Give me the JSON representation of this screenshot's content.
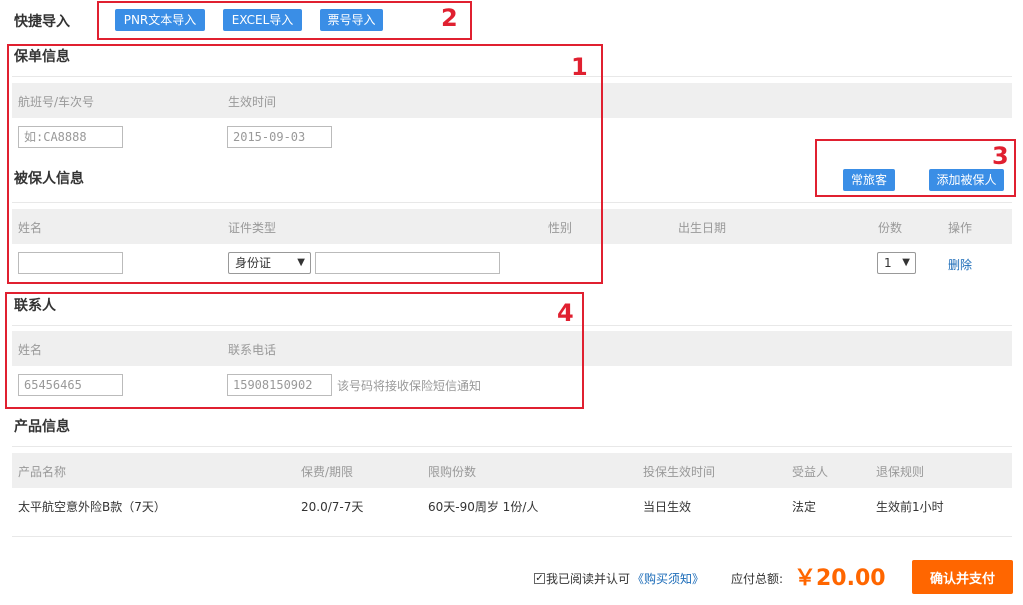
{
  "quick_import": {
    "title": "快捷导入",
    "buttons": [
      "PNR文本导入",
      "EXCEL导入",
      "票号导入"
    ]
  },
  "policy": {
    "title": "保单信息",
    "col_flight": "航班号/车次号",
    "col_effective": "生效时间",
    "flight_placeholder": "如:CA8888",
    "effective_value": "2015-09-03"
  },
  "insured": {
    "title": "被保人信息",
    "frequent_btn": "常旅客",
    "add_btn": "添加被保人",
    "columns": {
      "name": "姓名",
      "id_type": "证件类型",
      "gender": "性别",
      "birth": "出生日期",
      "copies": "份数",
      "action": "操作"
    },
    "id_type_value": "身份证",
    "copies_value": "1",
    "delete_label": "删除"
  },
  "contact": {
    "title": "联系人",
    "col_name": "姓名",
    "col_phone": "联系电话",
    "name_value": "65456465",
    "phone_value": "15908150902",
    "phone_hint": "该号码将接收保险短信通知"
  },
  "product": {
    "title": "产品信息",
    "columns": [
      "产品名称",
      "保费/期限",
      "限购份数",
      "投保生效时间",
      "受益人",
      "退保规则"
    ],
    "rows": [
      [
        "太平航空意外险B款（7天）",
        "20.0/7-7天",
        "60天-90周岁 1份/人",
        "当日生效",
        "法定",
        "生效前1小时"
      ]
    ]
  },
  "footer": {
    "agree_text": "我已阅读并认可",
    "agree_link": "《购买须知》",
    "total_label": "应付总额:",
    "total_amount": "￥20.00",
    "confirm_btn": "确认并支付",
    "checked": true
  },
  "annotations": [
    "1",
    "2",
    "3",
    "4"
  ],
  "colors": {
    "primary_blue": "#3a8ee6",
    "accent_orange": "#ff6600",
    "annotation_red": "#e02030"
  }
}
